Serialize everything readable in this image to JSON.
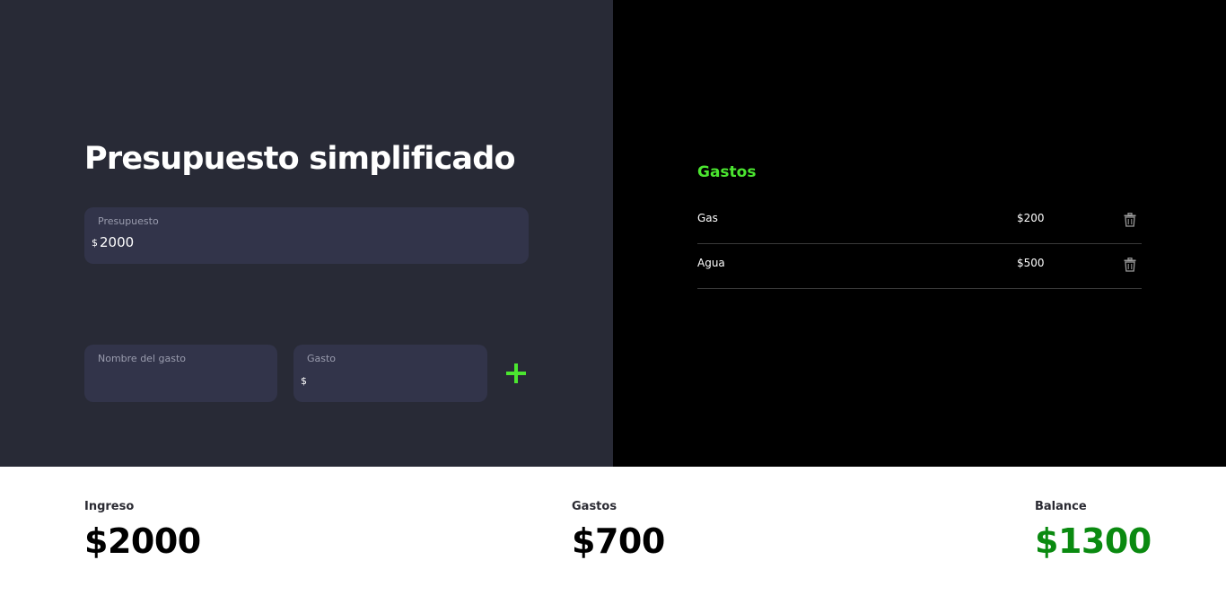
{
  "app": {
    "title": "Presupuesto simplificado"
  },
  "budget": {
    "label": "Presupuesto",
    "currency": "$",
    "value": "2000"
  },
  "new_expense": {
    "name_label": "Nombre del gasto",
    "name_value": "",
    "amount_label": "Gasto",
    "amount_currency": "$",
    "amount_value": "",
    "add_icon": "plus-icon"
  },
  "expenses": {
    "title": "Gastos",
    "items": [
      {
        "name": "Gas",
        "amount": "$200",
        "delete_icon": "trash-icon"
      },
      {
        "name": "Agua",
        "amount": "$500",
        "delete_icon": "trash-icon"
      }
    ]
  },
  "summary": {
    "income_label": "Ingreso",
    "income_value": "$2000",
    "expenses_label": "Gastos",
    "expenses_value": "$700",
    "balance_label": "Balance",
    "balance_value": "$1300"
  },
  "colors": {
    "left_panel": "#282a36",
    "right_panel": "#000000",
    "field_bg": "#32344a",
    "accent_green": "#4be630",
    "balance_green": "#0a8a10"
  }
}
